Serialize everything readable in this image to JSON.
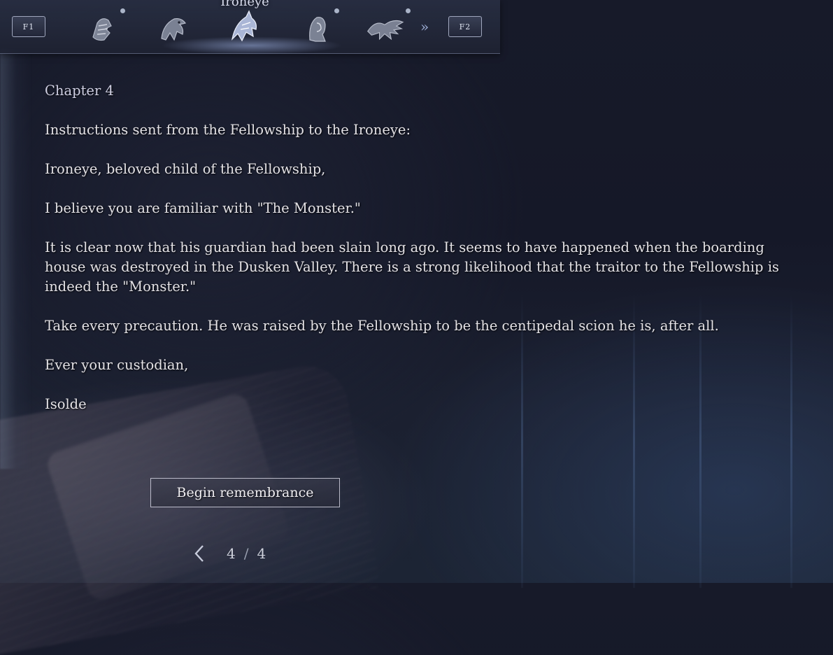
{
  "colors": {
    "background": "#171a29",
    "text": "#e4e2e6",
    "accent_glow": "#a0b4e6",
    "button_border": "#d2d2e1"
  },
  "topbar": {
    "left_key": "F1",
    "right_key": "F2",
    "active_tab_label": "Ironeye",
    "tabs": [
      {
        "icon": "wylder-helmet-icon",
        "active": false,
        "has_notification": true
      },
      {
        "icon": "guardian-bird-icon",
        "active": false,
        "has_notification": false
      },
      {
        "icon": "ironeye-bird-icon",
        "active": true,
        "has_notification": false
      },
      {
        "icon": "hooded-woman-icon",
        "active": false,
        "has_notification": true
      },
      {
        "icon": "wing-crest-icon",
        "active": false,
        "has_notification": true
      }
    ],
    "more_icon": "double-chevron-right-icon"
  },
  "letter": {
    "chapter": "Chapter 4",
    "heading": "Instructions sent from the Fellowship to the Ironeye:",
    "greeting": "Ironeye, beloved child of the Fellowship,",
    "p1": "I believe you are familiar with \"The Monster.\"",
    "p2": "It is clear now that his guardian had been slain long ago. It seems to have happened when the boarding house was destroyed in the Dusken Valley. There is a strong likelihood that the traitor to the Fellowship is indeed the \"Monster.\"",
    "p3": "Take every precaution. He was raised by the Fellowship to be the centipedal scion he is, after all.",
    "closing": "Ever your custodian,",
    "signature": "Isolde"
  },
  "actions": {
    "begin_label": "Begin remembrance"
  },
  "pager": {
    "current": "4",
    "separator": "/",
    "total": "4",
    "prev_icon": "chevron-left-icon"
  }
}
